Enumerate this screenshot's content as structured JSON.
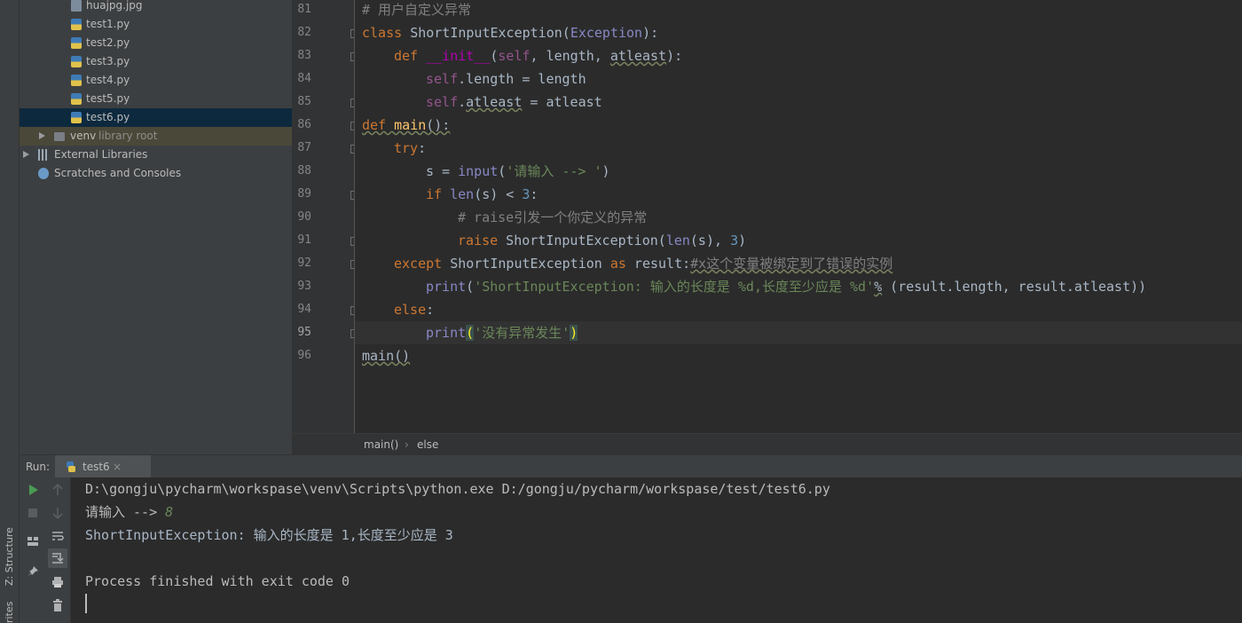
{
  "side_tabs": {
    "structure": "Z: Structure",
    "favorites": "rites"
  },
  "project_tree": {
    "items": [
      {
        "label": "huajpg.jpg",
        "icon": "image-file-icon"
      },
      {
        "label": "test1.py",
        "icon": "python-file-icon"
      },
      {
        "label": "test2.py",
        "icon": "python-file-icon"
      },
      {
        "label": "test3.py",
        "icon": "python-file-icon"
      },
      {
        "label": "test4.py",
        "icon": "python-file-icon"
      },
      {
        "label": "test5.py",
        "icon": "python-file-icon"
      },
      {
        "label": "test6.py",
        "icon": "python-file-icon",
        "selected": true
      }
    ],
    "venv": {
      "label": "venv",
      "suffix": "library root"
    },
    "external": "External Libraries",
    "scratches": "Scratches and Consoles"
  },
  "editor": {
    "line_numbers": [
      "81",
      "82",
      "83",
      "84",
      "85",
      "86",
      "87",
      "88",
      "89",
      "90",
      "91",
      "92",
      "93",
      "94",
      "95",
      "96"
    ],
    "current_line": "95",
    "lines": {
      "l81": {
        "cmt": "# 用户自定义异常"
      },
      "l82": {
        "kw": "class",
        "name": "ShortInputException",
        "open": "(",
        "base": "Exception",
        "close": "):"
      },
      "l83": {
        "kw": "def",
        "fn": "__init__",
        "open": "(",
        "self": "self",
        "params": ", length, ",
        "atleast": "atleast",
        "close": "):"
      },
      "l84": {
        "self": "self",
        "rest": ".length = length"
      },
      "l85": {
        "self": "self",
        "dot": ".",
        "atleast": "atleast",
        "rest": " = atleast"
      },
      "l86": {
        "kw": "def",
        "fn": "main",
        "rest": "():"
      },
      "l87": {
        "kw": "try",
        "rest": ":"
      },
      "l88": {
        "pre": "s = ",
        "builtin": "input",
        "open": "(",
        "str": "'请输入 --> '",
        "close": ")"
      },
      "l89": {
        "kw": "if",
        "builtin": "len",
        "mid": "(s) < ",
        "num": "3",
        "close": ":"
      },
      "l90": {
        "cmt": "# raise引发一个你定义的异常"
      },
      "l91": {
        "kw": "raise",
        "name": " ShortInputException(",
        "builtin": "len",
        "mid": "(s), ",
        "num": "3",
        "close": ")"
      },
      "l92": {
        "kw": "except",
        "name": " ShortInputException ",
        "kw2": "as",
        "rest": " result:",
        "cmt": "#x这个变量被绑定到了错误的实例"
      },
      "l93": {
        "builtin": "print",
        "open": "(",
        "str": "'ShortInputException: 输入的长度是 %d,长度至少应是 %d'",
        "pct": "%",
        "rest": " (result.length, result.atleast))"
      },
      "l94": {
        "kw": "else",
        "rest": ":"
      },
      "l95": {
        "builtin": "print",
        "open": "(",
        "str": "'没有异常发生'",
        "close": ")"
      },
      "l96": {
        "fn": "main",
        "rest": "()"
      }
    }
  },
  "breadcrumb": {
    "items": [
      "main()",
      "else"
    ],
    "separator": "›"
  },
  "run": {
    "label": "Run:",
    "tab": "test6",
    "tab_close": "×",
    "console": {
      "command": "D:\\gongju\\pycharm\\workspase\\venv\\Scripts\\python.exe D:/gongju/pycharm/workspase/test/test6.py",
      "prompt": "请输入 --> ",
      "input": "8",
      "error": "ShortInputException: 输入的长度是 1,长度至少应是 3",
      "finished": "Process finished with exit code 0"
    }
  }
}
